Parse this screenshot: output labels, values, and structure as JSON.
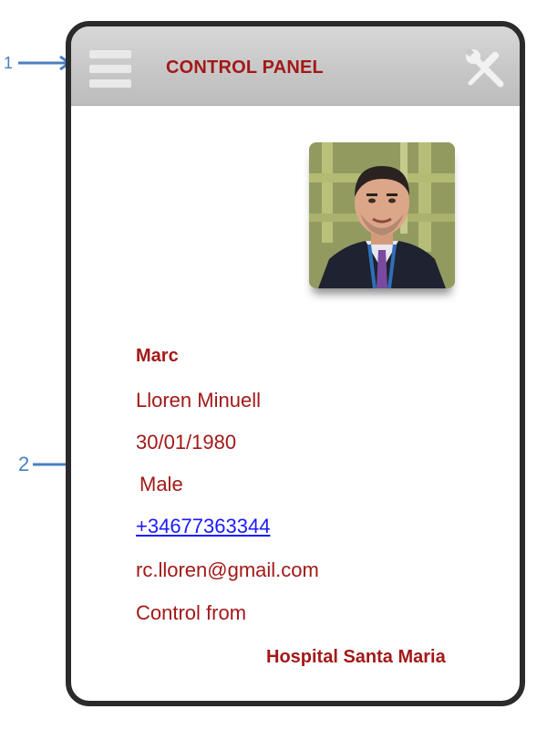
{
  "annotations": {
    "marker_1": "1",
    "marker_2": "2"
  },
  "header": {
    "title": "CONTROL PANEL",
    "menu_icon": "hamburger-menu-icon",
    "tools_icon": "wrench-screwdriver-icon"
  },
  "profile": {
    "photo_alt": "Marc",
    "first_name": "Marc",
    "surname": "Lloren Minuell",
    "birth_date": "30/01/1980",
    "gender": "Male",
    "phone": "+34677363344",
    "email": "rc.lloren@gmail.com",
    "control_label": "Control from",
    "hospital": "Hospital Santa Maria"
  },
  "colors": {
    "accent_red": "#a31818",
    "link_blue": "#1a1aff",
    "annotation_blue": "#4a7fc0",
    "header_gray": "#c6c6c6"
  }
}
